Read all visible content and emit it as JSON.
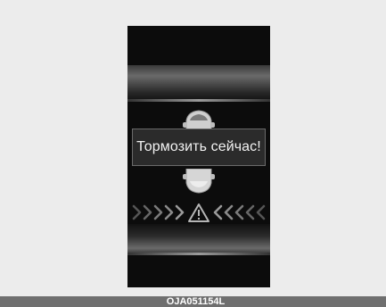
{
  "alert": {
    "message": "Тормозить сейчас!"
  },
  "icons": {
    "front_car": "car-front-icon",
    "rear_car": "car-rear-icon",
    "warning": "warning-triangle-icon",
    "arrows_left": "chevrons-right-icon",
    "arrows_right": "chevrons-left-icon"
  },
  "colors": {
    "display_bg": "#0c0c0c",
    "alert_bg": "#2b2b2b",
    "caption_bar": "#6f6f6f"
  },
  "caption": {
    "code": "OJA051154L"
  }
}
